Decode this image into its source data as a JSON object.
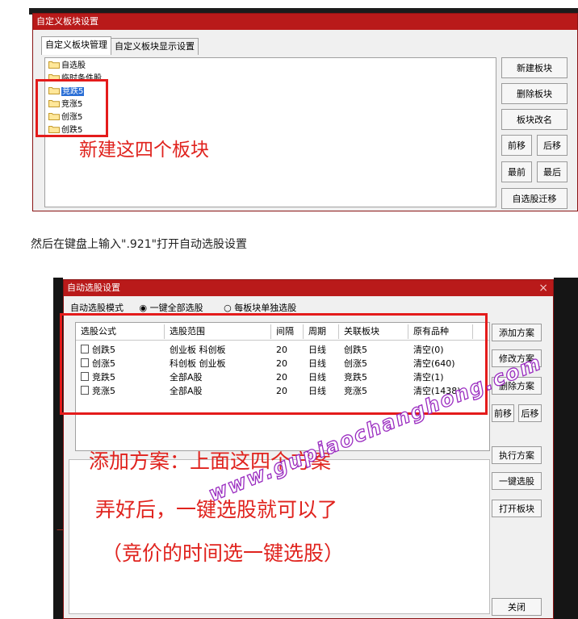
{
  "dialog1": {
    "title": "自定义板块设置",
    "close": "×",
    "tabs": [
      "自定义板块管理",
      "自定义板块显示设置"
    ],
    "tree_items": [
      {
        "label": "自选股",
        "selected": false
      },
      {
        "label": "临时条件股",
        "selected": false
      },
      {
        "label": "竞跌5",
        "selected": true
      },
      {
        "label": "竞涨5",
        "selected": false
      },
      {
        "label": "创涨5",
        "selected": false
      },
      {
        "label": "创跌5",
        "selected": false
      }
    ],
    "buttons": {
      "new_block": "新建板块",
      "delete_block": "删除板块",
      "rename_block": "板块改名",
      "move_up": "前移",
      "move_down": "后移",
      "move_first": "最前",
      "move_last": "最后",
      "migrate": "自选股迁移"
    },
    "annotation": "新建这四个板块"
  },
  "instruction_text": "然后在键盘上输入\".921\"打开自动选股设置",
  "dialog2": {
    "title": "自动选股设置",
    "close": "×",
    "mode_label": "自动选股模式",
    "mode_options": [
      "一键全部选股",
      "每板块单独选股"
    ],
    "mode_selected": 0,
    "columns": [
      "选股公式",
      "选股范围",
      "间隔",
      "周期",
      "关联板块",
      "原有品种"
    ],
    "rows": [
      [
        "创跌5",
        "创业板 科创板",
        "20",
        "日线",
        "创跌5",
        "清空(0)"
      ],
      [
        "创涨5",
        "科创板 创业板",
        "20",
        "日线",
        "创涨5",
        "清空(640)"
      ],
      [
        "竞跌5",
        "全部A股",
        "20",
        "日线",
        "竞跌5",
        "清空(1)"
      ],
      [
        "竞涨5",
        "全部A股",
        "20",
        "日线",
        "竞涨5",
        "清空(1438)"
      ]
    ],
    "buttons": {
      "add_plan": "添加方案",
      "edit_plan": "修改方案",
      "delete_plan": "删除方案",
      "move_up": "前移",
      "move_down": "后移",
      "run_plan": "执行方案",
      "one_key": "一键选股",
      "open_block": "打开板块",
      "close": "关闭"
    },
    "annotation_lines": [
      "添加方案：上面这四个方案",
      "弄好后，一键选股就可以了",
      "（竞价的时间选一键选股）"
    ]
  },
  "watermark": "www.gupiaochanghong.com",
  "colors": {
    "title_bar": "#b91a1a",
    "annotation_red": "#e0231e",
    "selection_blue": "#2b6fd6",
    "watermark_purple": "#9a2cc0"
  }
}
